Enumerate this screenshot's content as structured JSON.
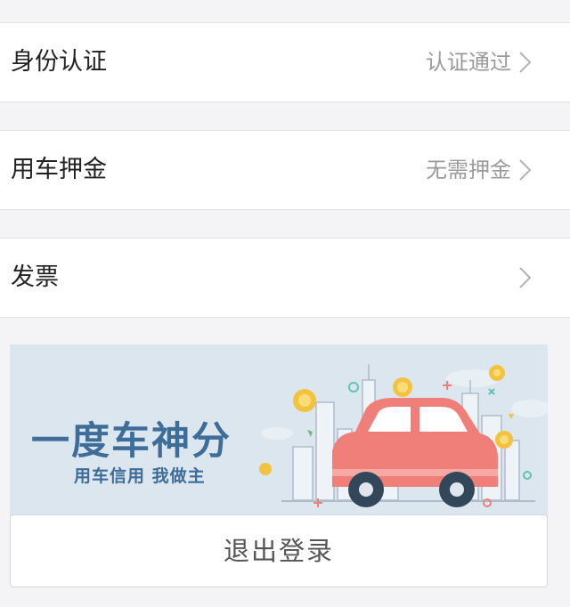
{
  "settings": {
    "items": [
      {
        "label": "身份认证",
        "value": "认证通过"
      },
      {
        "label": "用车押金",
        "value": "无需押金"
      },
      {
        "label": "发票",
        "value": ""
      }
    ]
  },
  "banner": {
    "title": "一度车神分",
    "subtitle": "用车信用 我做主",
    "colors": {
      "background": "#dce6ee",
      "car": "#ef7f78",
      "text": "#3d6d98",
      "coin": "#f3c23f"
    }
  },
  "logout": {
    "label": "退出登录"
  },
  "icons": {
    "chevron": "chevron-right-icon"
  }
}
